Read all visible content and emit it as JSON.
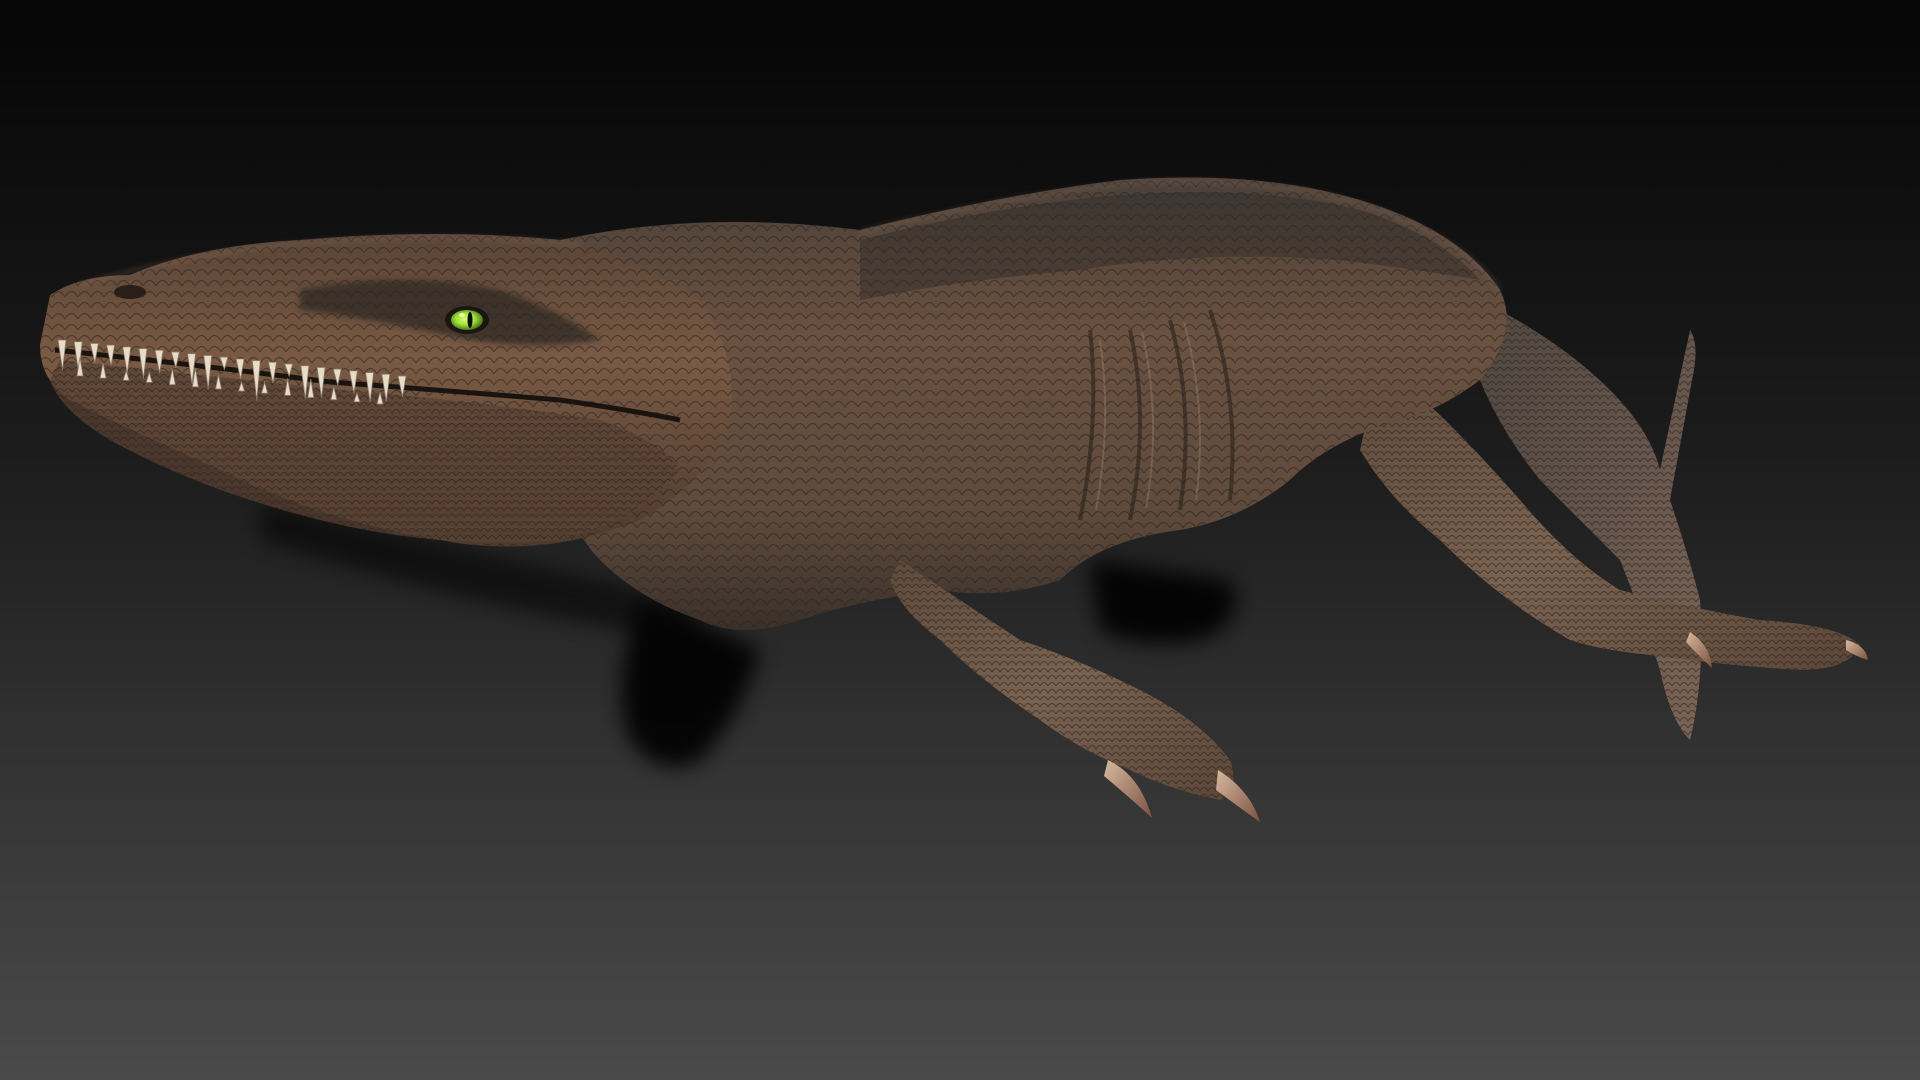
{
  "scene": {
    "subject": "creature-sculpt",
    "colors": {
      "background_top": "#050505",
      "background_bottom": "#4a4a4a",
      "skin_base": "#6b5140",
      "skin_dark": "#3a3530",
      "skin_warm": "#8a6448",
      "belly": "#7a6a58",
      "teeth": "#e8dcc8",
      "claws": "#b89078",
      "eye": "#9ee03a",
      "shadow": "#000000"
    }
  }
}
